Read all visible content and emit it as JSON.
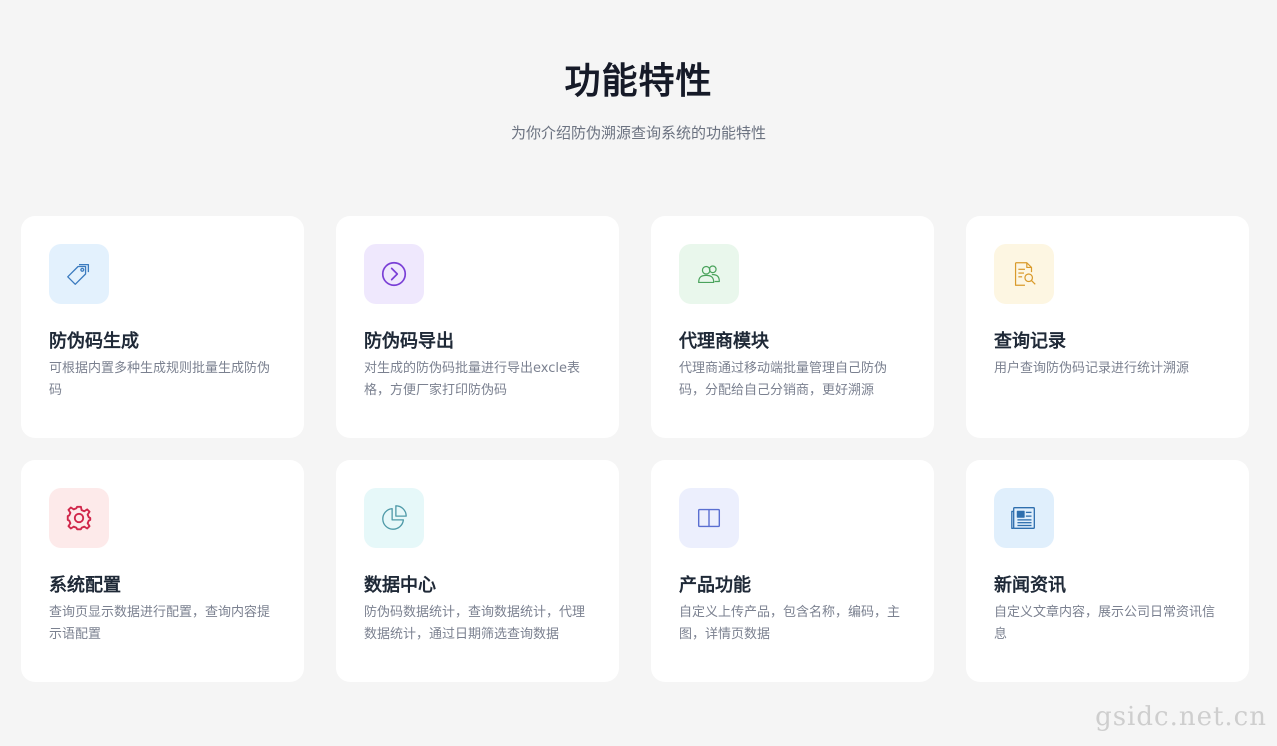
{
  "header": {
    "title": "功能特性",
    "subtitle": "为你介绍防伪溯源查询系统的功能特性"
  },
  "features": [
    {
      "title": "防伪码生成",
      "desc": "可根据内置多种生成规则批量生成防伪码",
      "icon": "tags-icon",
      "bg": "#e3f1fd",
      "color": "#3b7bbf"
    },
    {
      "title": "防伪码导出",
      "desc": "对生成的防伪码批量进行导出excle表格，方便厂家打印防伪码",
      "icon": "arrow-circle-right-icon",
      "bg": "#efe8fd",
      "color": "#7a3fd6"
    },
    {
      "title": "代理商模块",
      "desc": "代理商通过移动端批量管理自己防伪码，分配给自己分销商，更好溯源",
      "icon": "users-icon",
      "bg": "#e9f7ec",
      "color": "#4aa35c"
    },
    {
      "title": "查询记录",
      "desc": "用户查询防伪码记录进行统计溯源",
      "icon": "document-search-icon",
      "bg": "#fdf6e2",
      "color": "#d99a2b"
    },
    {
      "title": "系统配置",
      "desc": "查询页显示数据进行配置，查询内容提示语配置",
      "icon": "gear-icon",
      "bg": "#fdeaea",
      "color": "#d0264a"
    },
    {
      "title": "数据中心",
      "desc": "防伪码数据统计，查询数据统计，代理数据统计，通过日期筛选查询数据",
      "icon": "pie-chart-icon",
      "bg": "#e6f8f9",
      "color": "#4f9aa8"
    },
    {
      "title": "产品功能",
      "desc": "自定义上传产品，包含名称，编码，主图，详情页数据",
      "icon": "book-icon",
      "bg": "#eceffd",
      "color": "#5a6fd1"
    },
    {
      "title": "新闻资讯",
      "desc": "自定义文章内容，展示公司日常资讯信息",
      "icon": "newspaper-icon",
      "bg": "#e0effc",
      "color": "#2f6fae"
    }
  ],
  "watermark": "gsidc.net.cn"
}
